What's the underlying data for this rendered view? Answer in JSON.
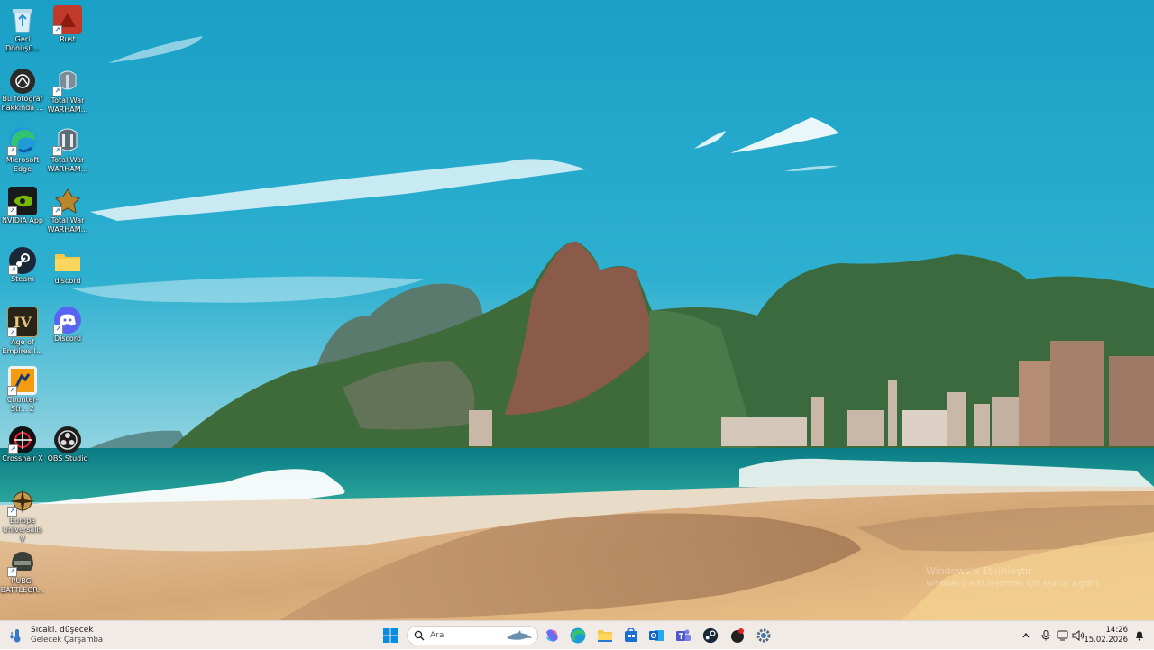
{
  "desktop": {
    "icons": [
      {
        "id": "recycle",
        "label": "Geri Dönüşü..."
      },
      {
        "id": "rust",
        "label": "Rust"
      },
      {
        "id": "about-photo",
        "label": "Bu fotoğraf hakkında ..."
      },
      {
        "id": "tw1",
        "label": "Total War WARHAM..."
      },
      {
        "id": "edge",
        "label": "Microsoft Edge"
      },
      {
        "id": "tw2",
        "label": "Total War WARHAM..."
      },
      {
        "id": "nvidia",
        "label": "NVIDIA App"
      },
      {
        "id": "tw3",
        "label": "Total War WARHAM..."
      },
      {
        "id": "steam",
        "label": "Steam"
      },
      {
        "id": "discord-folder",
        "label": "discord"
      },
      {
        "id": "aoe",
        "label": "Age of Empires I..."
      },
      {
        "id": "discord",
        "label": "Discord"
      },
      {
        "id": "cs2",
        "label": "Counter-Str... 2"
      },
      {
        "id": "crosshair",
        "label": "Crosshair X"
      },
      {
        "id": "obs",
        "label": "OBS Studio"
      },
      {
        "id": "eu",
        "label": "Europa Universalis V"
      },
      {
        "id": "pubg",
        "label": "PUBG: BATTLEGR..."
      }
    ],
    "watermark": {
      "line1": "Windows'u Etkinleştir",
      "line2": "Windows'u etkinleştirmek için Ayarlar'a gidin."
    }
  },
  "taskbar": {
    "weather": {
      "title": "Sıcakl. düşecek",
      "subtitle": "Gelecek Çarşamba",
      "icon": "weather-thermometer-icon"
    },
    "search_placeholder": "Ara",
    "apps": [
      "start-icon",
      "search-icon",
      "widgets-icon",
      "copilot-icon",
      "edge-icon",
      "file-explorer-icon",
      "store-icon",
      "outlook-icon",
      "teams-icon",
      "steam-icon",
      "record-icon",
      "settings-icon"
    ],
    "clock": {
      "time": "14:26",
      "date": "15.02.2026"
    }
  },
  "colors": {
    "taskbar_bg": "#f1ebe7",
    "accent": "#0067c0"
  }
}
